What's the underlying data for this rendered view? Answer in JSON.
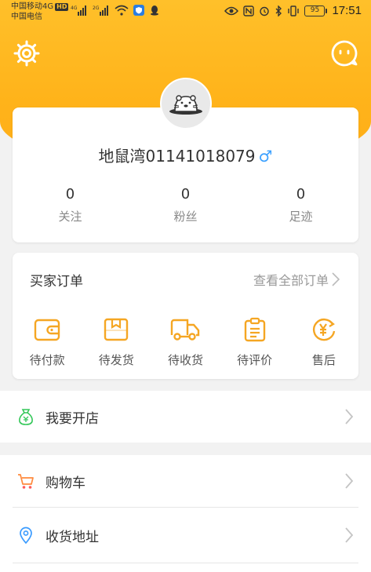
{
  "statusbar": {
    "carrier1": "中国移动4G",
    "hd": "HD",
    "carrier2": "中国电信",
    "battery": "95",
    "time": "17:51"
  },
  "header": {
    "settings_icon": "gear-icon",
    "message_icon": "chat-bubble-icon",
    "accent_color": "#ffb31a"
  },
  "profile": {
    "username": "地鼠湾01141018079",
    "gender_symbol": "♂",
    "stats": [
      {
        "num": "0",
        "label": "关注"
      },
      {
        "num": "0",
        "label": "粉丝"
      },
      {
        "num": "0",
        "label": "足迹"
      }
    ]
  },
  "orders": {
    "title": "买家订单",
    "view_all": "查看全部订单",
    "items": [
      {
        "label": "待付款",
        "icon": "wallet-icon"
      },
      {
        "label": "待发货",
        "icon": "package-icon"
      },
      {
        "label": "待收货",
        "icon": "truck-icon"
      },
      {
        "label": "待评价",
        "icon": "clipboard-icon"
      },
      {
        "label": "售后",
        "icon": "yen-refund-icon"
      }
    ],
    "icon_color": "#f5a623"
  },
  "menu": {
    "open_shop": "我要开店",
    "cart": "购物车",
    "address": "收货地址"
  }
}
